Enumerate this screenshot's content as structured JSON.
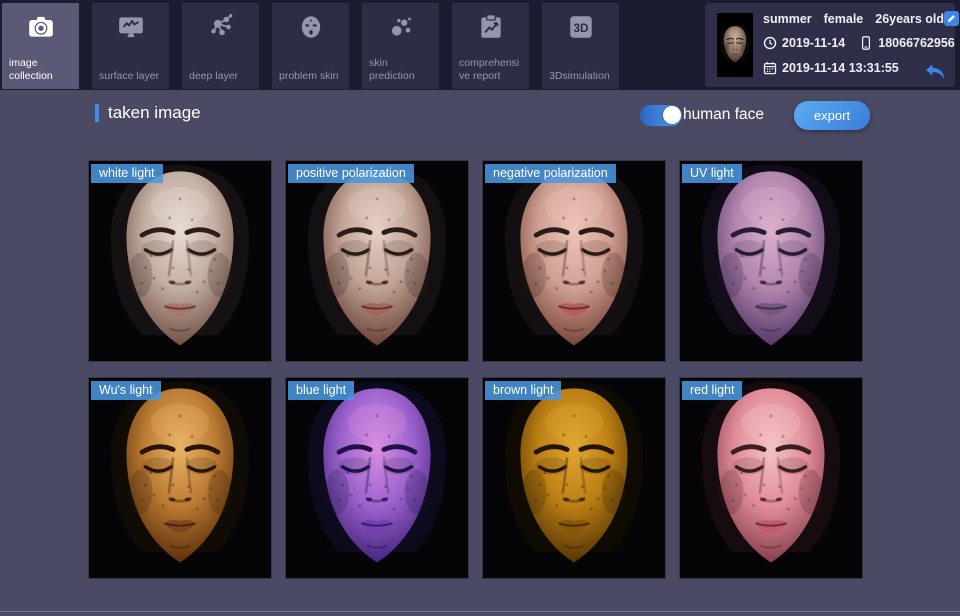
{
  "toolbar": {
    "tabs": [
      {
        "label": "image collection",
        "icon": "camera-icon",
        "active": true
      },
      {
        "label": "surface layer",
        "icon": "monitor-wave-icon",
        "active": false
      },
      {
        "label": "deep layer",
        "icon": "network-nodes-icon",
        "active": false
      },
      {
        "label": "problem skin",
        "icon": "face-icon",
        "active": false
      },
      {
        "label": "skin prediction",
        "icon": "bubbles-icon",
        "active": false
      },
      {
        "label": "comprehensive report",
        "icon": "report-clipboard-icon",
        "active": false
      },
      {
        "label": "3Dsimulation",
        "icon": "3d-cube-icon",
        "active": false
      }
    ]
  },
  "patient": {
    "name": "summer",
    "gender": "female",
    "age": "26years old",
    "date": "2019-11-14",
    "phone": "18066762956",
    "datetime": "2019-11-14 13:31:55",
    "icons": [
      "edit-icon",
      "clock-icon",
      "phone-icon",
      "calendar-icon",
      "back-icon"
    ]
  },
  "section": {
    "title": "taken image",
    "toggle_label": "human face",
    "toggle_on": true,
    "export_label": "export"
  },
  "gallery": {
    "items": [
      {
        "label": "white light",
        "palette": {
          "hi": "#e9dcd2",
          "skin": "#c3aea2",
          "sh": "#77584c",
          "dk": "#372620",
          "brow": "#2c1f19",
          "lip": "#ad7468",
          "hair": "#151011"
        }
      },
      {
        "label": "positive polarization",
        "palette": {
          "hi": "#e6cfc4",
          "skin": "#c0a396",
          "sh": "#70493e",
          "dk": "#34211b",
          "brow": "#2a1d17",
          "lip": "#a5655a",
          "hair": "#141012"
        }
      },
      {
        "label": "negative polarization",
        "palette": {
          "hi": "#ecc5b8",
          "skin": "#d0a092",
          "sh": "#7e4c40",
          "dk": "#38211b",
          "brow": "#2a1b16",
          "lip": "#b85b5e",
          "hair": "#130f10"
        }
      },
      {
        "label": "UV light",
        "palette": {
          "hi": "#dcb0cc",
          "skin": "#b286ae",
          "sh": "#5c3e6c",
          "dk": "#281a3a",
          "brow": "#271c36",
          "lip": "#77567c",
          "hair": "#110c18"
        }
      },
      {
        "label": "Wu's light",
        "palette": {
          "hi": "#eab468",
          "skin": "#bb7c33",
          "sh": "#63340d",
          "dk": "#2c1505",
          "brow": "#291404",
          "lip": "#7e4420",
          "hair": "#110b05"
        }
      },
      {
        "label": "blue light",
        "palette": {
          "hi": "#d88fe0",
          "skin": "#9d63cd",
          "sh": "#4b2a86",
          "dk": "#1e1042",
          "brow": "#1f1246",
          "lip": "#7040b4",
          "hair": "#0e0a1e"
        }
      },
      {
        "label": "brown light",
        "palette": {
          "hi": "#e2a832",
          "skin": "#bb7f14",
          "sh": "#5e3a06",
          "dk": "#2a1a02",
          "brow": "#241502",
          "lip": "#84560a",
          "hair": "#0f0a02"
        }
      },
      {
        "label": "red light",
        "palette": {
          "hi": "#f4c3c6",
          "skin": "#e18e99",
          "sh": "#8e4453",
          "dk": "#431c25",
          "brow": "#3b1d23",
          "lip": "#c25a67",
          "hair": "#160b0e"
        }
      }
    ]
  },
  "thumb_palette": {
    "hi": "#c8b0a0",
    "skin": "#93796c",
    "sh": "#4e3830",
    "dk": "#201511",
    "brow": "#1c120e",
    "lip": "#7a544a",
    "hair": "#0c0909"
  },
  "colors": {
    "accent_blue": "#3d85ea",
    "chip_blue": "#4a96de",
    "toolbar_bg": "#1c1c30",
    "tab_bg": "#2d2d46",
    "tab_active_bg": "#5a5a76",
    "content_bg": "#4a4a65"
  }
}
